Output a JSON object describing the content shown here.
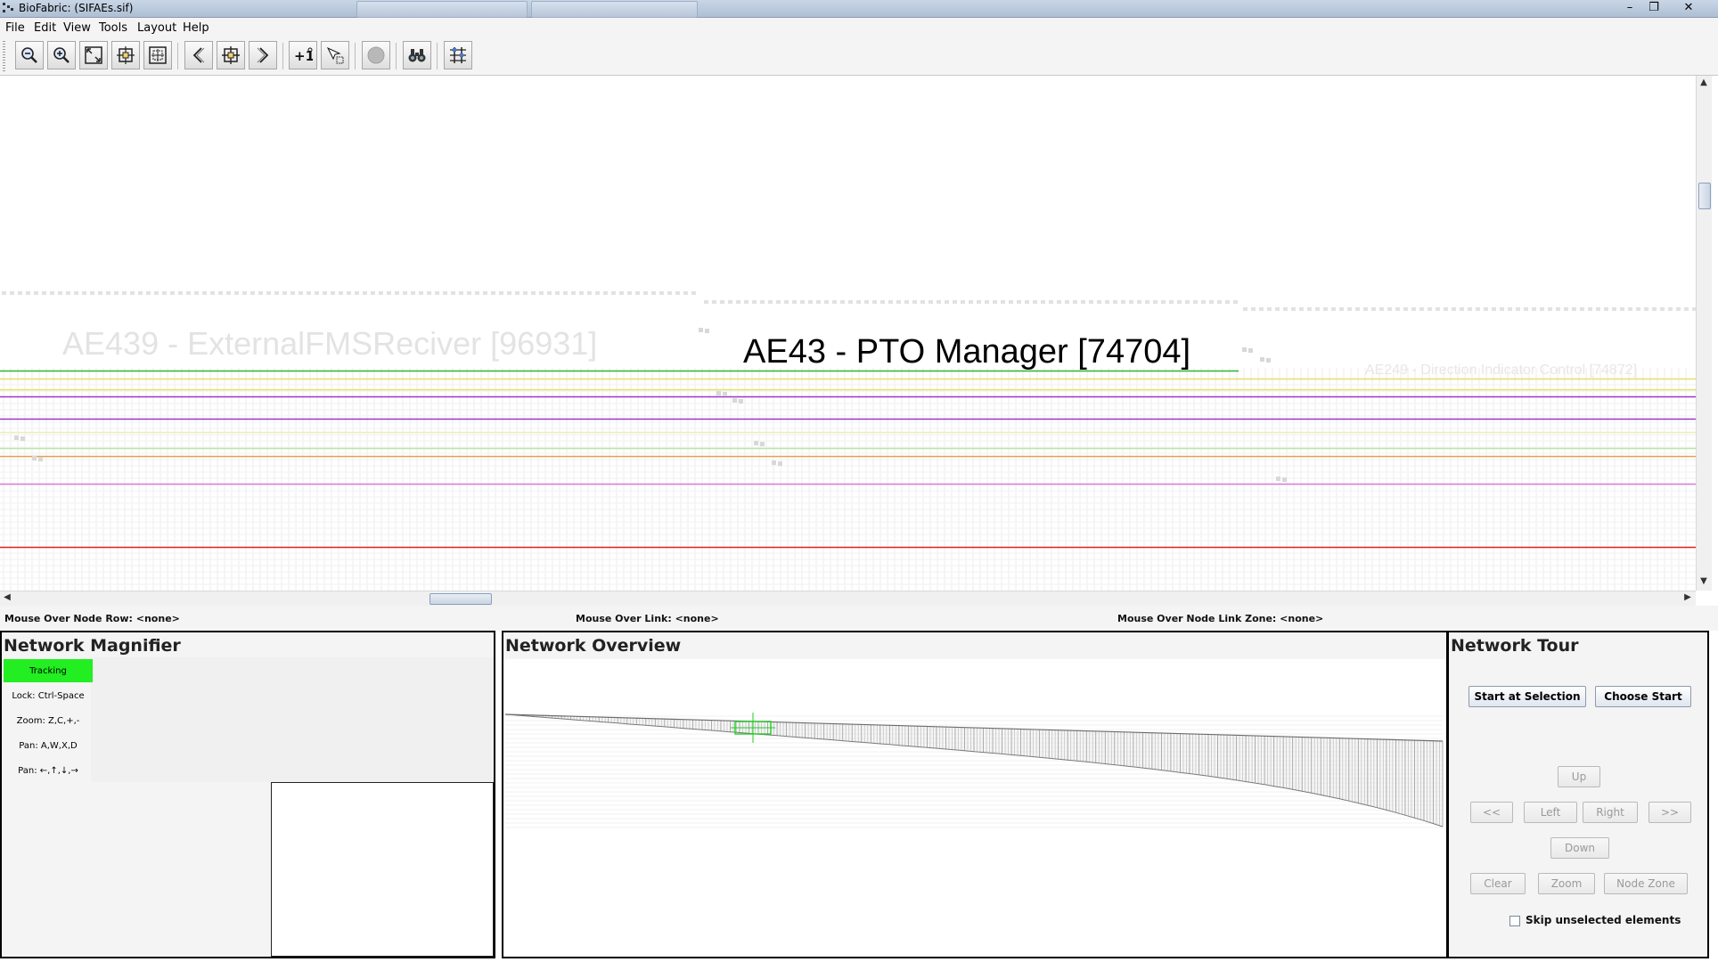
{
  "window": {
    "title": "BioFabric: (SIFAEs.sif)",
    "controls": [
      "–",
      "❐",
      "✕"
    ]
  },
  "menu": [
    "File",
    "Edit",
    "View",
    "Tools",
    "Layout",
    "Help"
  ],
  "toolbar": {
    "icons": [
      "zoom-out-icon",
      "zoom-in-icon",
      "zoom-to-model-icon",
      "zoom-to-rect-icon",
      "zoom-to-selection-icon",
      "prev-selection-icon",
      "center-selection-icon",
      "next-selection-icon",
      "add-first-neighbors-icon",
      "select-mode-icon",
      "stop-icon",
      "search-icon",
      "layout-settings-icon"
    ]
  },
  "canvas": {
    "focus_label": "AE43 - PTO Manager [74704]",
    "faint_label_left": "AE439 - ExternalFMSReciver [96931]",
    "faint_label_right": "AE249 - Direction Indicator Control [74872]"
  },
  "status": {
    "node_row": "Mouse Over Node Row: <none>",
    "link": "Mouse Over Link: <none>",
    "node_link_zone": "Mouse Over Node Link Zone: <none>"
  },
  "magnifier": {
    "title": "Network Magnifier",
    "hints": [
      "Tracking",
      "Lock: Ctrl-Space",
      "Zoom: Z,C,+,-",
      "Pan: A,W,X,D",
      "Pan: ←,↑,↓,→"
    ]
  },
  "overview": {
    "title": "Network Overview"
  },
  "tour": {
    "title": "Network Tour",
    "start_at_selection": "Start at Selection",
    "choose_start": "Choose Start",
    "up": "Up",
    "far_left": "<<",
    "left": "Left",
    "right": "Right",
    "far_right": ">>",
    "down": "Down",
    "clear": "Clear",
    "zoom": "Zoom",
    "node_zone": "Node Zone",
    "skip_label": "Skip unselected elements"
  },
  "colors": {
    "tracking": "#22ee22",
    "line_green": "#2db52d",
    "line_yellow": "#e7e06a",
    "line_purple": "#9a39c9",
    "line_orange": "#e8a04a",
    "line_pink": "#d97ad9",
    "line_red": "#e02020"
  }
}
